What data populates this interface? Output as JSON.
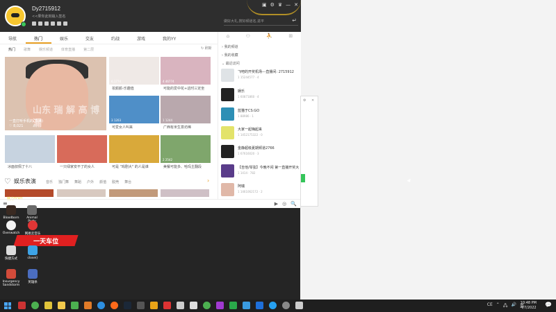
{
  "window": {
    "username": "Dy2715912",
    "signature": "<<果你此刻输入签名",
    "controls": [
      "▣",
      "⚙",
      "♛",
      "—",
      "✕"
    ],
    "search_placeholder": "做好大礼,搜好频道名,进平",
    "enter_glyph": "↵"
  },
  "nav": {
    "tabs": [
      "导航",
      "热门",
      "娱乐",
      "交友",
      "约战",
      "游戏",
      "我的YY"
    ],
    "active": "热门"
  },
  "subnav": {
    "items": [
      "热门",
      "歌舞",
      "娱乐频道",
      "体育直播",
      "第二层"
    ],
    "refresh": "刷新"
  },
  "feature": {
    "caption1": "一直打听手机的(直播)",
    "caption2": "♡ 8,021",
    "watermark": "山东 瑞 解 高 博 漏"
  },
  "thumbs": [
    {
      "count": "6,1774",
      "label": "妆颜颜-乐趣值"
    },
    {
      "count": "4 46774",
      "label": "可能的爱中花+这时三定坐"
    },
    {
      "count": "3 1203",
      "label": "可爱女人叫来"
    },
    {
      "count": "1 1244",
      "label": "广西有米生意坊稀"
    },
    {
      "count": "",
      "label": "冰面叔佩了十八"
    },
    {
      "count": "",
      "label": "一只绿家安不了的女人"
    },
    {
      "count": "",
      "label": "可是 \"戏剧大\" 的人是谁"
    },
    {
      "count": "2 2542",
      "label": "美餐可能多、哈玛主翻段"
    }
  ],
  "entertainment": {
    "title": "娱乐表演",
    "tags": [
      "音乐",
      "独门舞",
      "舞蹈",
      "户外",
      "颜值",
      "脱壳",
      "舞台"
    ],
    "promo": "魅力TOP1"
  },
  "right_panel": {
    "tabs": [
      "⌂",
      "⚇",
      "⛹",
      "⊞"
    ],
    "sections": [
      "我的频道",
      "我的收藏",
      "最近访问"
    ],
    "items": [
      {
        "title": "飞吧的开奖机场---直播间: 2715912",
        "meta": "1 15244577  ·  4"
      },
      {
        "title": "娱乐",
        "meta": "1 60871860  ·  4"
      },
      {
        "title": "蓝猫于CS:GO",
        "meta": "1 88986  ·  1"
      },
      {
        "title": "大家一起嗨起来",
        "meta": "1 1452175322  ·  0"
      },
      {
        "title": "金静超级夏期频道2766",
        "meta": "1 67616020  ·  3"
      },
      {
        "title": "【吉他/琴弦】今晚不闲 第一直播开奖大",
        "meta": "1 1414  ·  782"
      },
      {
        "title": "阿瑞",
        "meta": "1 1461062172  ·  2"
      }
    ]
  },
  "bottombar": {
    "menu": "≡",
    "icons": [
      "▶",
      "◎",
      "🔍"
    ]
  },
  "desktop": {
    "icons": [
      {
        "label": "Bloodborn"
      },
      {
        "label": "Animal Party"
      },
      {
        "label": "Overwatch"
      },
      {
        "label": "网易云音乐"
      },
      {
        "label": "快捷方式"
      },
      {
        "label": "close()"
      },
      {
        "label": "Insurgency Sandstorm"
      },
      {
        "label": "英雄杀"
      }
    ],
    "banner": "一天车位"
  },
  "taskbar": {
    "tray": [
      "CE",
      "⌃",
      "🖧",
      "🔊",
      "英"
    ],
    "time": "10:48 PM",
    "date": "4/7/2022",
    "notif": "💬"
  }
}
